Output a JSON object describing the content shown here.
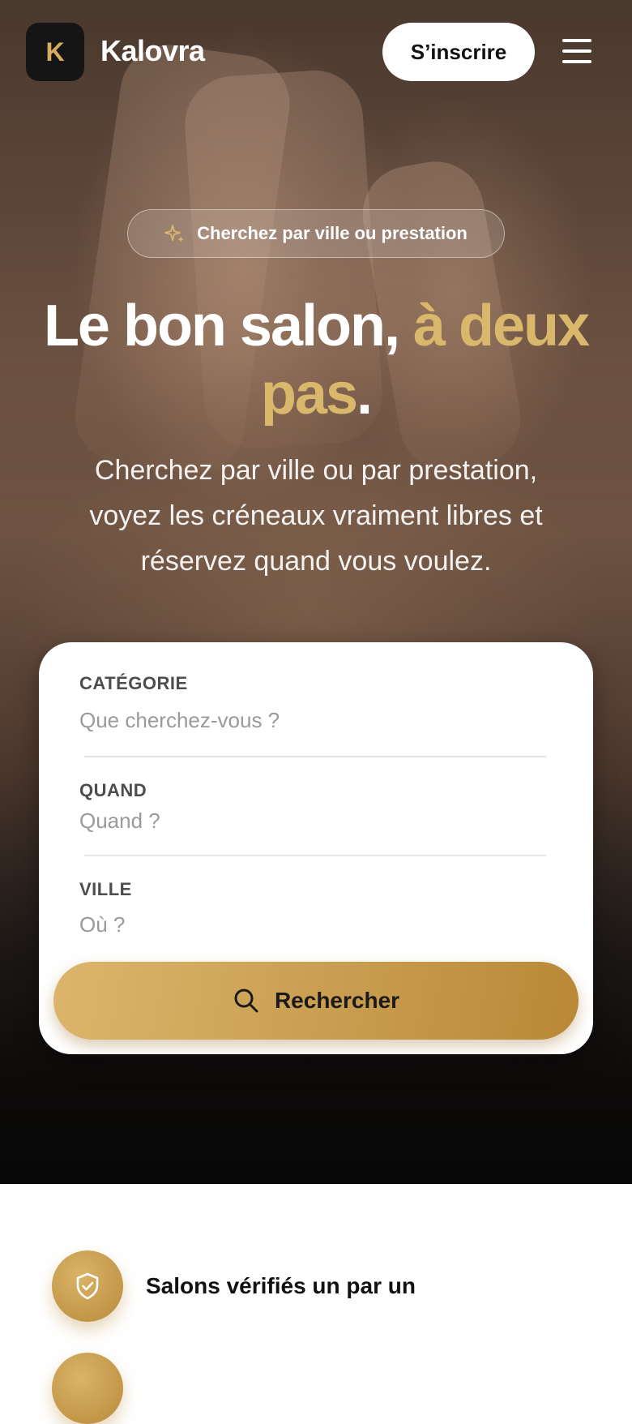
{
  "header": {
    "logo_letter": "K",
    "brand_name": "Kalovra",
    "signup_label": "S’inscrire",
    "menu_icon": "hamburger-menu-icon"
  },
  "hero": {
    "pill_icon": "sparkle-icon",
    "pill_text": "Cherchez par ville ou prestation",
    "headline_part1": "Le bon salon, ",
    "headline_part2_gold": "à deux pas",
    "headline_end": ".",
    "subtitle": "Cherchez par ville ou par prestation, voyez les créneaux vraiment libres et réservez quand vous voulez."
  },
  "search_card": {
    "category_label": "CATÉGORIE",
    "category_placeholder": "Que cherchez-vous ?",
    "when_label": "QUAND",
    "when_placeholder": "Quand ?",
    "city_label": "VILLE",
    "city_placeholder": "Où ?",
    "search_label": "Rechercher",
    "search_icon": "search-icon"
  },
  "features": [
    {
      "icon": "shield-check-icon",
      "label": "Salons vérifiés un par un"
    }
  ],
  "colors": {
    "gold": "#d9b86b",
    "button_gradient_start": "#dcb56c",
    "button_gradient_end": "#b88836",
    "logo_bg": "#151515"
  }
}
